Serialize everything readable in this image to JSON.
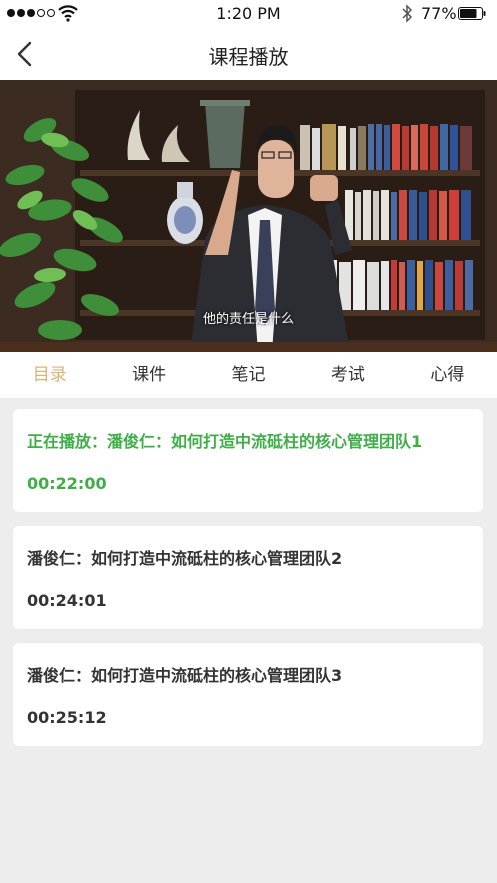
{
  "status_bar": {
    "time": "1:20 PM",
    "battery": "77%"
  },
  "header": {
    "title": "课程播放"
  },
  "video": {
    "subtitle": "他的责任是什么"
  },
  "tabs": [
    {
      "label": "目录",
      "active": true
    },
    {
      "label": "课件",
      "active": false
    },
    {
      "label": "笔记",
      "active": false
    },
    {
      "label": "考试",
      "active": false
    },
    {
      "label": "心得",
      "active": false
    }
  ],
  "lessons": [
    {
      "title": "正在播放：潘俊仁：如何打造中流砥柱的核心管理团队1",
      "duration": "00:22:00",
      "playing": true
    },
    {
      "title": "潘俊仁：如何打造中流砥柱的核心管理团队2",
      "duration": "00:24:01",
      "playing": false
    },
    {
      "title": "潘俊仁：如何打造中流砥柱的核心管理团队3",
      "duration": "00:25:12",
      "playing": false
    }
  ],
  "colors": {
    "accent_tab": "#d8b477",
    "playing": "#3fae49",
    "background": "#ededed"
  },
  "icons": {
    "back": "chevron-left-icon",
    "wifi": "wifi-icon",
    "bluetooth": "bluetooth-icon",
    "battery": "battery-icon"
  }
}
